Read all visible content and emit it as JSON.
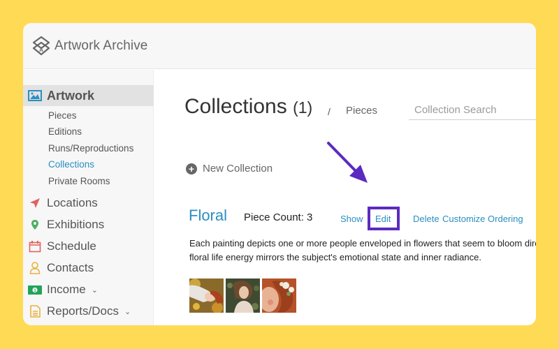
{
  "app": {
    "brand": "Artwork Archive",
    "logo_icon": "artwork-archive-logo"
  },
  "sidebar": {
    "artwork": {
      "label": "Artwork",
      "icon": "image-icon",
      "icon_color": "#2a8fc1"
    },
    "artwork_sub": [
      {
        "label": "Pieces"
      },
      {
        "label": "Editions"
      },
      {
        "label": "Runs/Reproductions"
      },
      {
        "label": "Collections",
        "current": true
      },
      {
        "label": "Private Rooms"
      }
    ],
    "items": [
      {
        "label": "Locations",
        "icon": "location-arrow-icon",
        "color": "#e0625f"
      },
      {
        "label": "Exhibitions",
        "icon": "map-pin-icon",
        "color": "#4caf63"
      },
      {
        "label": "Schedule",
        "icon": "calendar-icon",
        "color": "#e0625f"
      },
      {
        "label": "Contacts",
        "icon": "user-icon",
        "color": "#e8b33c"
      },
      {
        "label": "Income",
        "icon": "money-icon",
        "color": "#22a35a",
        "chevron": "⌄"
      },
      {
        "label": "Reports/Docs",
        "icon": "document-icon",
        "color": "#e8b33c",
        "chevron": "⌄"
      }
    ]
  },
  "main": {
    "title": "Collections",
    "title_count": "(1)",
    "breadcrumb_sep": "/",
    "breadcrumb_pieces": "Pieces",
    "search_placeholder": "Collection Search",
    "new_collection_label": "New Collection",
    "collection": {
      "name": "Floral",
      "piece_count_label": "Piece Count: 3",
      "actions": {
        "show": "Show",
        "edit": "Edit",
        "delete": "Delete",
        "customize": "Customize Ordering"
      },
      "description_line1": "Each painting depicts one or more people enveloped in flowers that seem to bloom directl",
      "description_line2": "floral life energy mirrors the subject's emotional state and inner radiance.",
      "thumbnails": [
        {
          "alt": "woman lying in flowers painting"
        },
        {
          "alt": "woman with flowers in hair painting"
        },
        {
          "alt": "red-haired woman with white flowers painting"
        }
      ]
    }
  },
  "annotation": {
    "color": "#5b2bbf",
    "target": "Edit"
  }
}
